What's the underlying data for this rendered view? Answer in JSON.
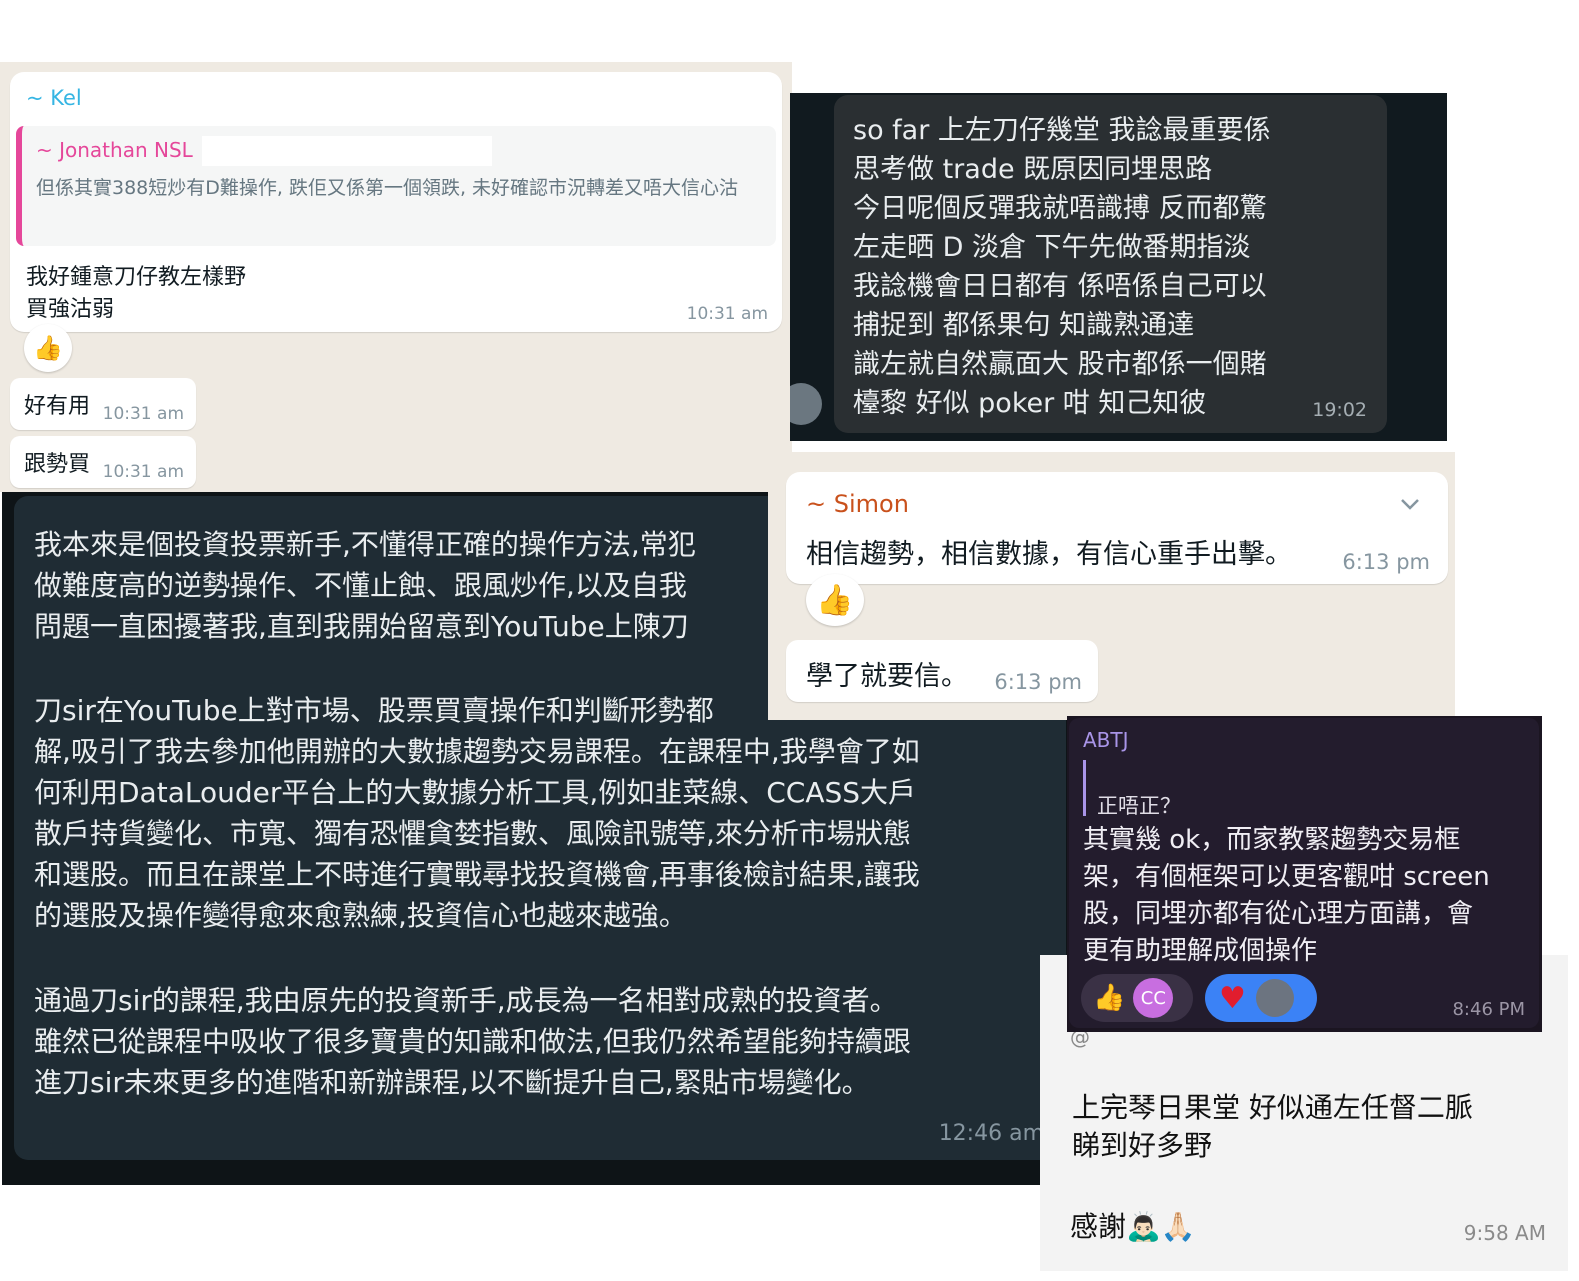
{
  "kel_chat": {
    "sender": "~ Kel",
    "quote_sender": "~ Jonathan NSL",
    "quote_text": "但係其實388短炒有D難操作, 跌佢又係第一個領跌, 未好確認市況轉差又唔大信心沽",
    "message": "我好鍾意刀仔教左樣野\n買強沽弱",
    "time": "10:31 am",
    "reaction": "👍",
    "msg2": "好有用",
    "msg2_time": "10:31 am",
    "msg3": "跟勢買",
    "msg3_time": "10:31 am"
  },
  "dark_chat_top": {
    "message": "so far 上左刀仔幾堂 我諗最重要係\n思考做 trade 既原因同埋思路\n今日呢個反彈我就唔識搏 反而都驚\n左走晒 D 淡倉 下午先做番期指淡\n我諗機會日日都有 係唔係自己可以\n捕捉到 都係果句 知識熟通達\n識左就自然贏面大 股市都係一個賭\n檯黎 好似 poker 咁 知己知彼",
    "time": "19:02"
  },
  "testimonial": {
    "paragraph1": "我本來是個投資投票新手,不懂得正確的操作方法,常犯\n做難度高的逆勢操作、不懂止蝕、跟風炒作,以及自我\n問題一直困擾著我,直到我開始留意到YouTube上陳刀",
    "paragraph2": "刀sir在YouTube上對市場、股票買賣操作和判斷形勢都\n解,吸引了我去參加他開辦的大數據趨勢交易課程。在課程中,我學會了如\n何利用DataLouder平台上的大數據分析工具,例如韭菜線、CCASS大戶\n散戶持貨變化、市寬、獨有恐懼貪婪指數、風險訊號等,來分析市場狀態\n和選股。而且在課堂上不時進行實戰尋找投資機會,再事後檢討結果,讓我\n的選股及操作變得愈來愈熟練,投資信心也越來越強。",
    "paragraph3": "通過刀sir的課程,我由原先的投資新手,成長為一名相對成熟的投資者。\n雖然已從課程中吸收了很多寶貴的知識和做法,但我仍然希望能夠持續跟\n進刀sir未來更多的進階和新辦課程,以不斷提升自己,緊貼市場變化。",
    "time": "12:46 am"
  },
  "simon_chat": {
    "sender": "~ Simon",
    "message": "相信趨勢，相信數據，有信心重手出擊。",
    "time": "6:13 pm",
    "reaction": "👍",
    "msg2": "學了就要信。",
    "msg2_time": "6:13 pm"
  },
  "abtj_chat": {
    "sender": "ABTJ",
    "quote": "正唔正？",
    "message": "其實幾 ok，而家教緊趨勢交易框\n架，有個框架可以更客觀咁 screen\n股，同埋亦都有從心理方面講，會\n更有助理解成個操作",
    "reaction1_emoji": "👍",
    "reaction1_initials": "CC",
    "reaction2_emoji": "♥",
    "time": "8:46 PM"
  },
  "last_chat": {
    "message": "上完琴日果堂 好似通左任督二脈\n睇到好多野",
    "thanks": "感謝🙇🏻‍♂️🙏🏻",
    "time": "9:58 AM"
  },
  "colors": {
    "wa_light_bg": "#efeae2",
    "wa_dark_bg": "#0b141a",
    "kel_name": "#35b5e3",
    "jonathan_name": "#e5479a",
    "simon_name": "#c9511c",
    "abtj_name": "#a995e8"
  }
}
